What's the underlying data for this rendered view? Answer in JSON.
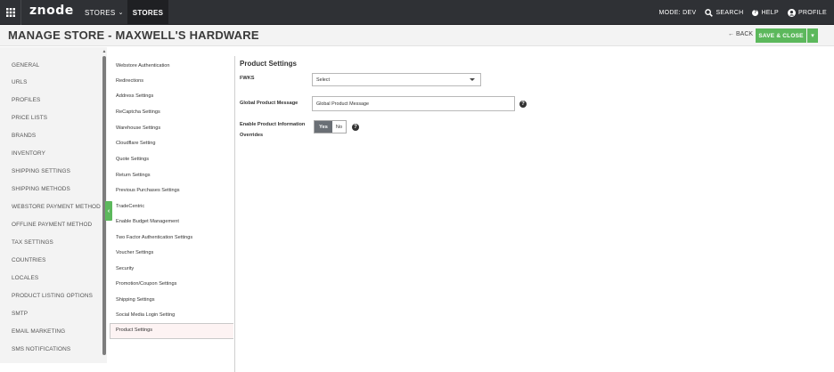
{
  "topbar": {
    "logo": "znode",
    "stores_menu": "STORES",
    "stores_active": "STORES",
    "mode": "MODE: DEV",
    "search": "SEARCH",
    "help": "HELP",
    "profile": "PROFILE"
  },
  "header": {
    "title": "MANAGE STORE - MAXWELL'S HARDWARE",
    "back": "BACK",
    "save_close": "SAVE & CLOSE"
  },
  "leftnav": {
    "items": [
      "GENERAL",
      "URLS",
      "PROFILES",
      "PRICE LISTS",
      "BRANDS",
      "INVENTORY",
      "SHIPPING SETTINGS",
      "SHIPPING METHODS",
      "WEBSTORE PAYMENT METHOD",
      "OFFLINE PAYMENT METHOD",
      "TAX SETTINGS",
      "COUNTRIES",
      "LOCALES",
      "PRODUCT LISTING OPTIONS",
      "SMTP",
      "EMAIL MARKETING",
      "SMS NOTIFICATIONS"
    ]
  },
  "subnav": {
    "items": [
      "Webstore Authentication",
      "Redirections",
      "Address Settings",
      "ReCaptcha Settings",
      "Warehouse Settings",
      "Cloudflare Setting",
      "Quote Settings",
      "Return Settings",
      "Previous Purchases Settings",
      "TradeCentric",
      "Enable Budget Management",
      "Two Factor Authentication Settings",
      "Voucher Settings",
      "Security",
      "Promotion/Coupon Settings",
      "Shipping Settings",
      "Social Media Login Setting"
    ],
    "selected": "Product Settings"
  },
  "main": {
    "section_title": "Product Settings",
    "fwks_label": "FWKS",
    "fwks_value": "Select",
    "global_msg_label": "Global Product Message",
    "global_msg_value": "Global Product Message",
    "overrides_label_1": "Enable Product Information",
    "overrides_label_2": "Overrides",
    "toggle_yes": "Yes",
    "toggle_no": "No"
  },
  "colors": {
    "topbar": "#2f3135",
    "accent_green": "#5cb85c",
    "toggle_active": "#6a6f75"
  }
}
